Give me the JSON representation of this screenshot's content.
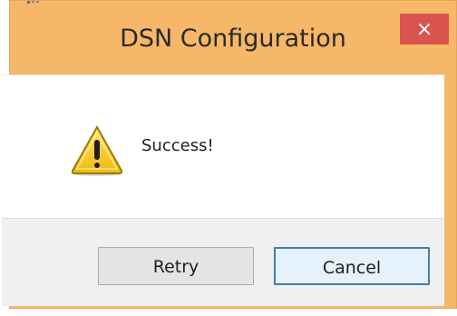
{
  "window": {
    "title": "DSN Configuration",
    "close_label": "×"
  },
  "dialog": {
    "message": "Success!",
    "icon": "warning-icon"
  },
  "buttons": {
    "retry_label": "Retry",
    "cancel_label": "Cancel"
  },
  "colors": {
    "frame": "#f7b768",
    "close_button": "#d9534f",
    "content_bg": "#ffffff",
    "footer_bg": "#f0f0f0",
    "default_button_border": "#3c7fb1",
    "default_button_bg": "#e5f1fb",
    "button_bg": "#e4e4e4"
  }
}
